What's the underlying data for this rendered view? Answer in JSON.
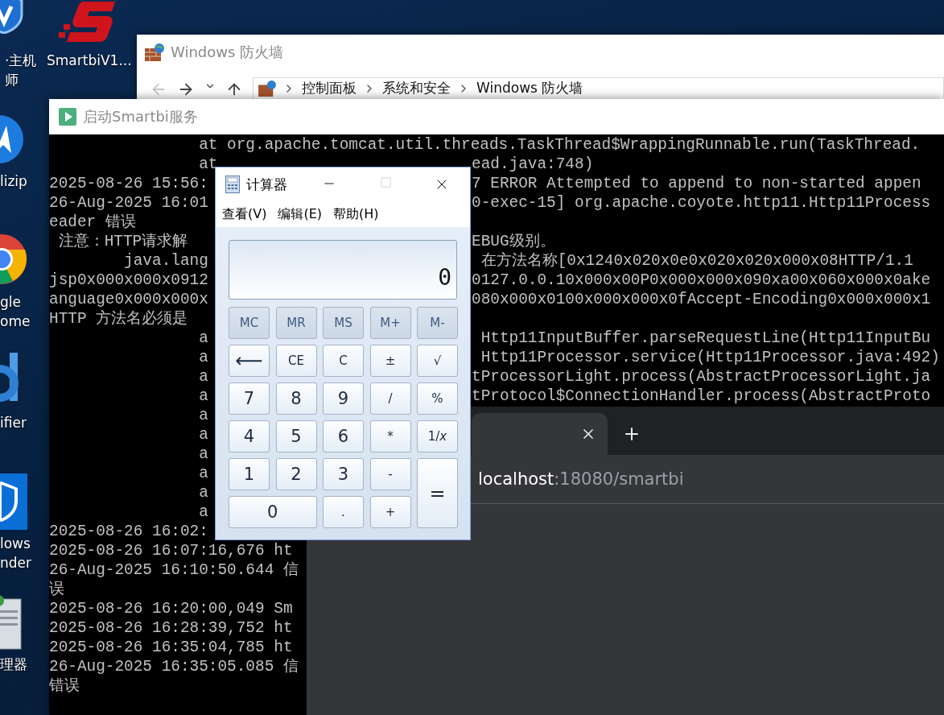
{
  "desktop": {
    "icons": [
      {
        "kind": "shield",
        "label_lines": [
          "·主机",
          "师"
        ]
      },
      {
        "kind": "smartbi",
        "label_lines": [
          "SmartbiV1..."
        ]
      },
      {
        "kind": "arrow-circle",
        "label_lines": [
          "lizip"
        ]
      },
      {
        "kind": "chrome",
        "label_lines": [
          "gle",
          "ome"
        ]
      },
      {
        "kind": "letter-d",
        "label_lines": [
          "ifier"
        ]
      },
      {
        "kind": "defender",
        "label_lines": [
          "lows",
          "nder"
        ]
      },
      {
        "kind": "server",
        "label_lines": [
          "理器"
        ]
      }
    ]
  },
  "firewall_window": {
    "title": "Windows 防火墙",
    "breadcrumb": [
      "控制面板",
      "系统和安全",
      "Windows 防火墙"
    ]
  },
  "console_window": {
    "title": "启动Smartbi服务",
    "lines": [
      {
        "kind": "full",
        "text": "                at org.apache.tomcat.util.threads.TaskThread$WrappingRunnable.run(TaskThread."
      },
      {
        "kind": "split",
        "left": "                at",
        "right": "ead.java:748)"
      },
      {
        "kind": "split",
        "left": "2025-08-26 15:56:",
        "right": "7 ERROR Attempted to append to non-started appen"
      },
      {
        "kind": "split",
        "left": "26-Aug-2025 16:01",
        "right": "0-exec-15] org.apache.coyote.http11.Http11Process"
      },
      {
        "kind": "split",
        "left": "eader 错误"
      },
      {
        "kind": "split",
        "left": " 注意：HTTP请求解",
        "right": "EBUG级别。"
      },
      {
        "kind": "split",
        "left": "        java.lang",
        "right": " 在方法名称[0x1240x020x0e0x020x020x000x08HTTP/1.1"
      },
      {
        "kind": "split",
        "left": "jsp0x000x000x0912",
        "right": "0127.0.0.10x000x00P0x000x000x090xa00x060x000x0ake"
      },
      {
        "kind": "split",
        "left": "anguage0x000x000x",
        "right": "080x000x0100x000x000x0fAccept-Encoding0x000x000x1"
      },
      {
        "kind": "split",
        "left": "HTTP 方法名必须是"
      },
      {
        "kind": "split",
        "left": "                a",
        "right": " Http11InputBuffer.parseRequestLine(Http11InputBu"
      },
      {
        "kind": "split",
        "left": "                a",
        "right": " Http11Processor.service(Http11Processor.java:492)"
      },
      {
        "kind": "split",
        "left": "                a",
        "right": "tProcessorLight.process(AbstractProcessorLight.ja"
      },
      {
        "kind": "split",
        "left": "                a",
        "right": "tProtocol$ConnectionHandler.process(AbstractProto"
      },
      {
        "kind": "split",
        "left": "                a"
      },
      {
        "kind": "split",
        "left": "                a"
      },
      {
        "kind": "split",
        "left": "                a"
      },
      {
        "kind": "split",
        "left": "                a"
      },
      {
        "kind": "split",
        "left": "                a"
      },
      {
        "kind": "split",
        "left": "                a"
      },
      {
        "kind": "split",
        "left": "2025-08-26 16:02:"
      },
      {
        "kind": "full",
        "text": "2025-08-26 16:07:16,676 ht"
      },
      {
        "kind": "full",
        "text": "26-Aug-2025 16:10:50.644 信"
      },
      {
        "kind": "full",
        "text": "误"
      },
      {
        "kind": "full",
        "text": "2025-08-26 16:20:00,049 Sm"
      },
      {
        "kind": "full",
        "text": "2025-08-26 16:28:39,752 ht"
      },
      {
        "kind": "full",
        "text": "2025-08-26 16:35:04,785 ht"
      },
      {
        "kind": "full",
        "text": "26-Aug-2025 16:35:05.085 信"
      },
      {
        "kind": "full",
        "text": "错误"
      }
    ]
  },
  "browser_window": {
    "tabs": [
      {
        "selected": true
      }
    ],
    "address": {
      "host": "localhost",
      "path": ":18080/smartbi"
    }
  },
  "calculator": {
    "title": "计算器",
    "menu": [
      "查看(V)",
      "编辑(E)",
      "帮助(H)"
    ],
    "display": "0",
    "buttons": [
      {
        "label": "MC",
        "kind": "memory"
      },
      {
        "label": "MR",
        "kind": "memory"
      },
      {
        "label": "MS",
        "kind": "memory"
      },
      {
        "label": "M+",
        "kind": "memory"
      },
      {
        "label": "M-",
        "kind": "memory"
      },
      {
        "label": "⟵",
        "kind": "normal"
      },
      {
        "label": "CE",
        "kind": "small"
      },
      {
        "label": "C",
        "kind": "small"
      },
      {
        "label": "±",
        "kind": "small"
      },
      {
        "label": "√",
        "kind": "small"
      },
      {
        "label": "7",
        "kind": "digit"
      },
      {
        "label": "8",
        "kind": "digit"
      },
      {
        "label": "9",
        "kind": "digit"
      },
      {
        "label": "/",
        "kind": "small"
      },
      {
        "label": "%",
        "kind": "small"
      },
      {
        "label": "4",
        "kind": "digit"
      },
      {
        "label": "5",
        "kind": "digit"
      },
      {
        "label": "6",
        "kind": "digit"
      },
      {
        "label": "*",
        "kind": "small"
      },
      {
        "label": "1/*x*",
        "kind": "small"
      },
      {
        "label": "1",
        "kind": "digit"
      },
      {
        "label": "2",
        "kind": "digit"
      },
      {
        "label": "3",
        "kind": "digit"
      },
      {
        "label": "-",
        "kind": "small"
      },
      {
        "label": "=",
        "kind": "tall"
      },
      {
        "label": "0",
        "kind": "wide"
      },
      {
        "label": ".",
        "kind": "small"
      },
      {
        "label": "+",
        "kind": "small"
      }
    ]
  }
}
